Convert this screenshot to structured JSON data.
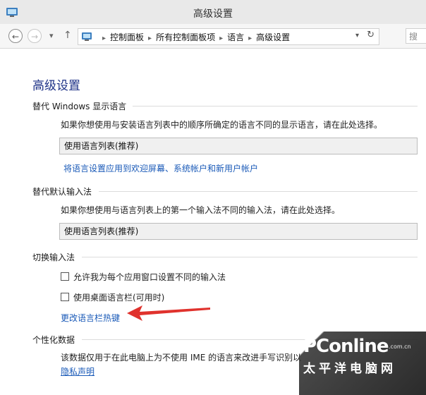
{
  "window": {
    "title": "高级设置"
  },
  "navbar": {
    "back_glyph": "←",
    "forward_glyph": "→",
    "history_glyph": "▾",
    "up_glyph": "↑",
    "breadcrumb": [
      "控制面板",
      "所有控制面板项",
      "语言",
      "高级设置"
    ],
    "breadcrumb_separator": "▸",
    "address_dropdown_glyph": "▾",
    "refresh_glyph": "↻",
    "search_text": "搜"
  },
  "page": {
    "title": "高级设置",
    "display_language": {
      "heading": "替代 Windows 显示语言",
      "description": "如果你想使用与安装语言列表中的顺序所确定的语言不同的显示语言，请在此处选择。",
      "select_value": "使用语言列表(推荐)",
      "link": "将语言设置应用到欢迎屏幕、系统帐户和新用户帐户"
    },
    "default_input": {
      "heading": "替代默认输入法",
      "description": "如果你想使用与语言列表上的第一个输入法不同的输入法，请在此处选择。",
      "select_value": "使用语言列表(推荐)"
    },
    "switch_input": {
      "heading": "切换输入法",
      "checkbox_per_app": "允许我为每个应用窗口设置不同的输入法",
      "checkbox_desktop_bar": "使用桌面语言栏(可用时)",
      "link_hotkeys": "更改语言栏热键"
    },
    "personalization": {
      "heading": "个性化数据",
      "description": "该数据仅用于在此电脑上为不使用 IME 的语言来改进手写识别以",
      "link_privacy": "隐私声明"
    }
  },
  "watermark": {
    "brand": "PConline",
    "domain": ".com.cn",
    "subtitle": "太平洋电脑网"
  },
  "colors": {
    "title_blue": "#1e3287",
    "link_blue": "#1a5ab8",
    "annotation_arrow": "#e0322d"
  }
}
